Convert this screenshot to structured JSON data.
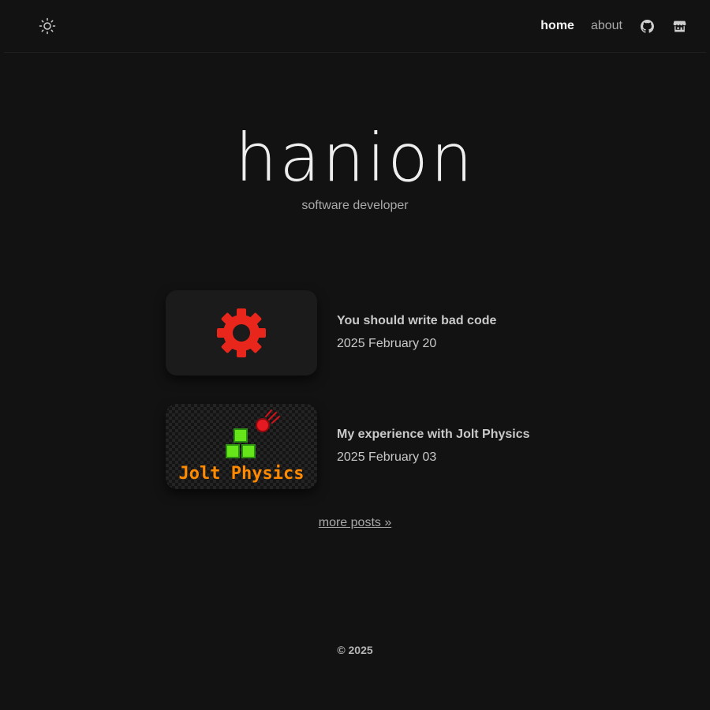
{
  "header": {
    "theme_toggle_icon": "sun-icon",
    "nav": {
      "home": "home",
      "about": "about",
      "github_icon": "github-icon",
      "store_icon": "storefront-icon"
    }
  },
  "hero": {
    "title": "hanion",
    "subtitle": "software developer"
  },
  "posts": [
    {
      "title": "You should write bad code",
      "date": "2025 February 20",
      "thumbnail_icon": "gear-icon",
      "accent": "#e8261c"
    },
    {
      "title": "My experience with Jolt Physics",
      "date": "2025 February 03",
      "thumbnail_text": "Jolt Physics",
      "accent": "#ff8a00"
    }
  ],
  "more_posts": "more posts »",
  "footer": {
    "copyright": "© 2025"
  }
}
